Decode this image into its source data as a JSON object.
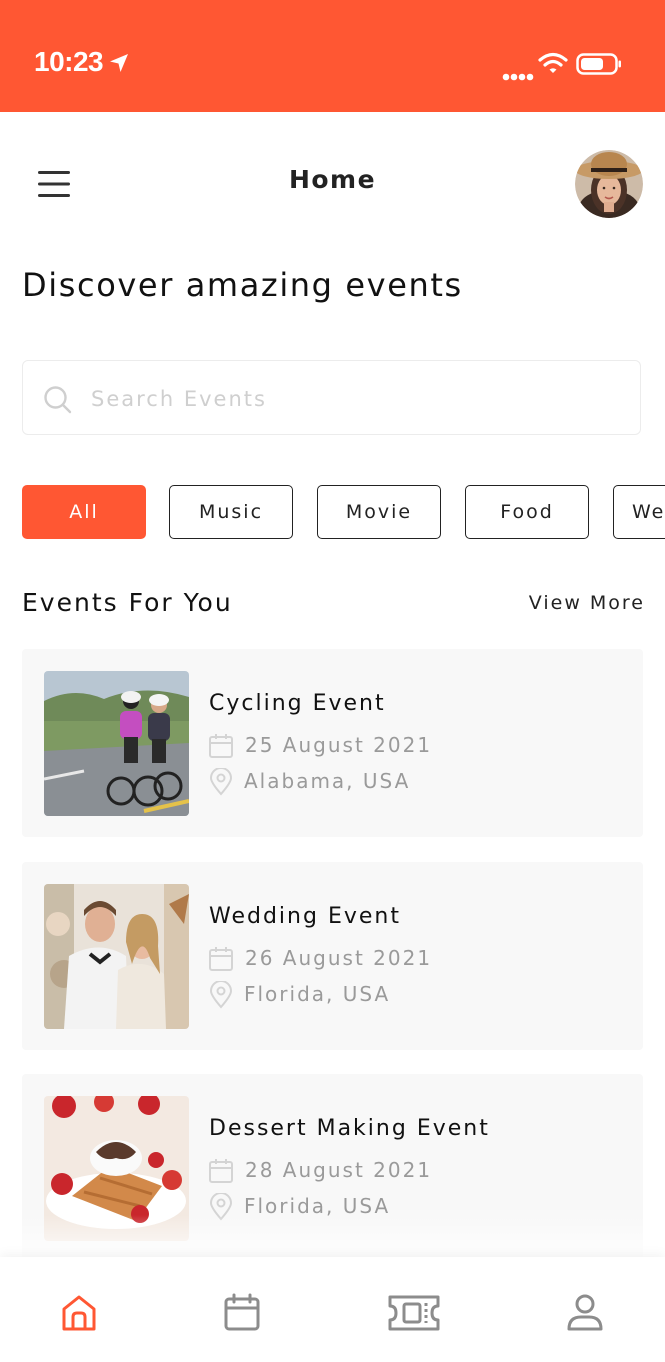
{
  "status_bar": {
    "time": "10:23",
    "icons": [
      "location-arrow-icon",
      "signal-dots-icon",
      "wifi-icon",
      "battery-icon"
    ]
  },
  "header": {
    "title": "Home",
    "menu_icon": "hamburger-menu-icon",
    "avatar": "user-avatar"
  },
  "page": {
    "title": "Discover amazing events"
  },
  "search": {
    "placeholder": "Search Events",
    "value": "",
    "icon": "search-icon"
  },
  "categories": [
    {
      "label": "All",
      "active": true
    },
    {
      "label": "Music",
      "active": false
    },
    {
      "label": "Movie",
      "active": false
    },
    {
      "label": "Food",
      "active": false
    },
    {
      "label": "We",
      "active": false
    }
  ],
  "events_section": {
    "title": "Events For You",
    "view_more": "View More"
  },
  "events": [
    {
      "name": "Cycling Event",
      "date": "25 August 2021",
      "location": "Alabama, USA",
      "image": "cycling-photo"
    },
    {
      "name": "Wedding Event",
      "date": "26 August 2021",
      "location": "Florida, USA",
      "image": "wedding-photo"
    },
    {
      "name": "Dessert Making Event",
      "date": "28 August 2021",
      "location": "Florida, USA",
      "image": "dessert-photo"
    }
  ],
  "bottom_nav": [
    {
      "icon": "home-icon",
      "active": true
    },
    {
      "icon": "calendar-icon",
      "active": false
    },
    {
      "icon": "ticket-icon",
      "active": false
    },
    {
      "icon": "profile-icon",
      "active": false
    }
  ],
  "colors": {
    "accent": "#FF5733",
    "card_bg": "#F8F8F8",
    "muted_text": "#9A9A9A",
    "nav_inactive": "#8C8C8C"
  }
}
